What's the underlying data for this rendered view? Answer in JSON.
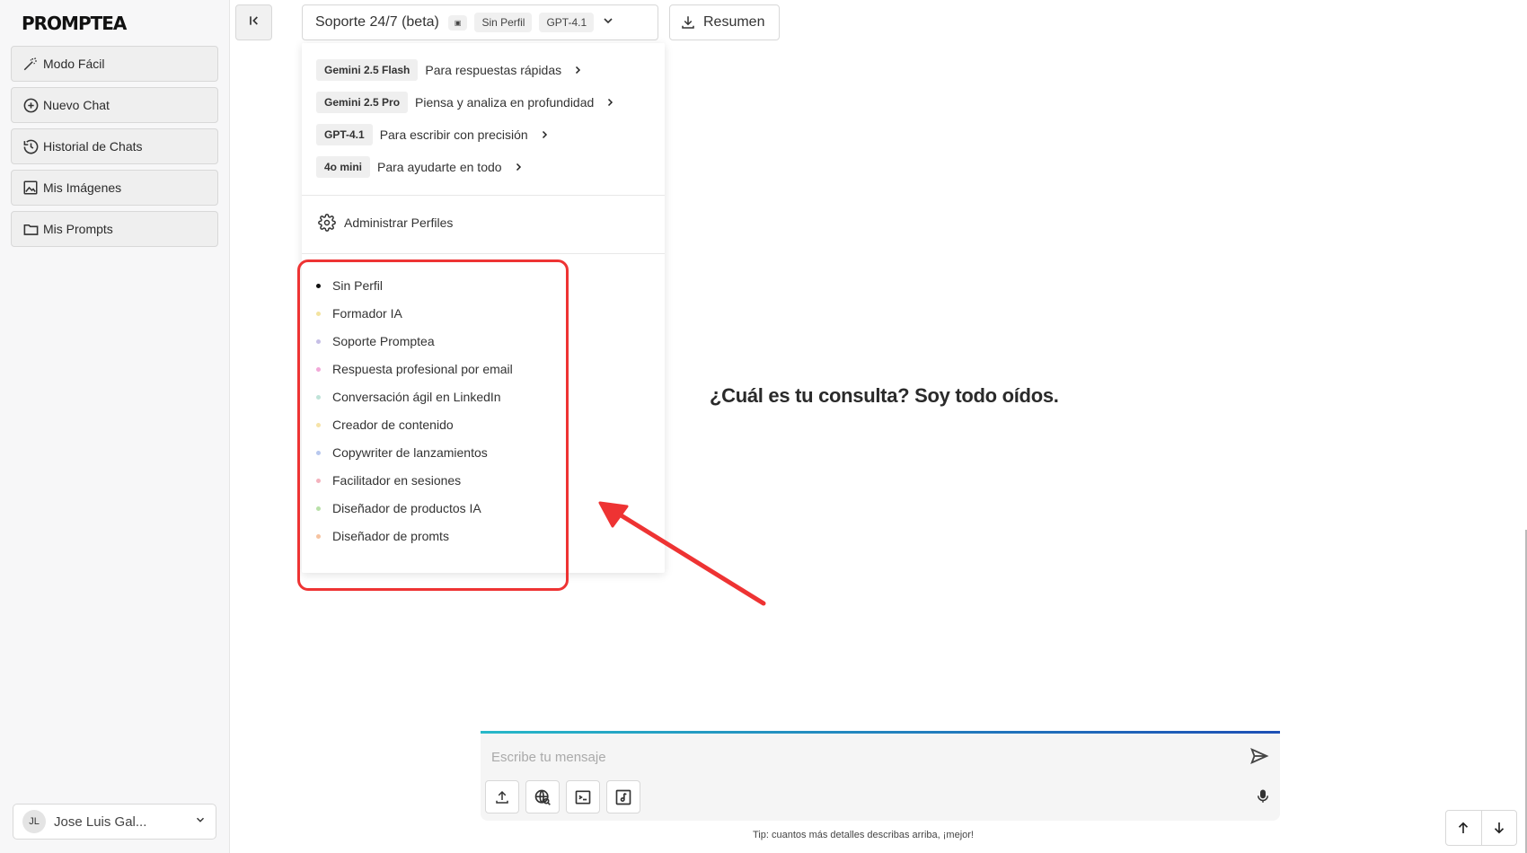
{
  "sidebar": {
    "logo": "PROMPTEA",
    "items": [
      {
        "label": "Modo Fácil",
        "icon": "magic-wand-icon"
      },
      {
        "label": "Nuevo Chat",
        "icon": "plus-circle-icon"
      },
      {
        "label": "Historial de Chats",
        "icon": "history-icon"
      },
      {
        "label": "Mis Imágenes",
        "icon": "image-icon"
      },
      {
        "label": "Mis Prompts",
        "icon": "folder-icon"
      }
    ],
    "user": {
      "initials": "JL",
      "name": "Jose Luis Gal..."
    }
  },
  "header": {
    "title": "Soporte 24/7 (beta)",
    "tag": "▣",
    "profile_chip": "Sin Perfil",
    "model_chip": "GPT-4.1",
    "summary_label": "Resumen"
  },
  "dropdown": {
    "models": [
      {
        "name": "Gemini 2.5 Flash",
        "desc": "Para respuestas rápidas"
      },
      {
        "name": "Gemini 2.5 Pro",
        "desc": "Piensa y analiza en profundidad"
      },
      {
        "name": "GPT-4.1",
        "desc": "Para escribir con precisión"
      },
      {
        "name": "4o mini",
        "desc": "Para ayudarte en todo"
      }
    ],
    "manage_label": "Administrar Perfiles",
    "profiles": [
      {
        "label": "Sin Perfil",
        "color": "#111111"
      },
      {
        "label": "Formador IA",
        "color": "#f3e3a0"
      },
      {
        "label": "Soporte Promptea",
        "color": "#c6bfe6"
      },
      {
        "label": "Respuesta profesional por email",
        "color": "#f2a8d8"
      },
      {
        "label": "Conversación ágil en LinkedIn",
        "color": "#bfe3d8"
      },
      {
        "label": "Creador de contenido",
        "color": "#f6e3a8"
      },
      {
        "label": "Copywriter de lanzamientos",
        "color": "#b8c8ee"
      },
      {
        "label": "Facilitador en sesiones",
        "color": "#f4b2bd"
      },
      {
        "label": "Diseñador de productos IA",
        "color": "#b8e0a8"
      },
      {
        "label": "Diseñador de promts",
        "color": "#f6c3a0"
      }
    ]
  },
  "main": {
    "prompt": "¿Cuál es tu consulta? Soy todo oídos."
  },
  "composer": {
    "placeholder": "Escribe tu mensaje",
    "tip": "Tip: cuantos más detalles describas arriba, ¡mejor!"
  },
  "colors": {
    "highlight": "#ee3333",
    "accent_start": "#27b8c8",
    "accent_end": "#1d4fb5"
  }
}
